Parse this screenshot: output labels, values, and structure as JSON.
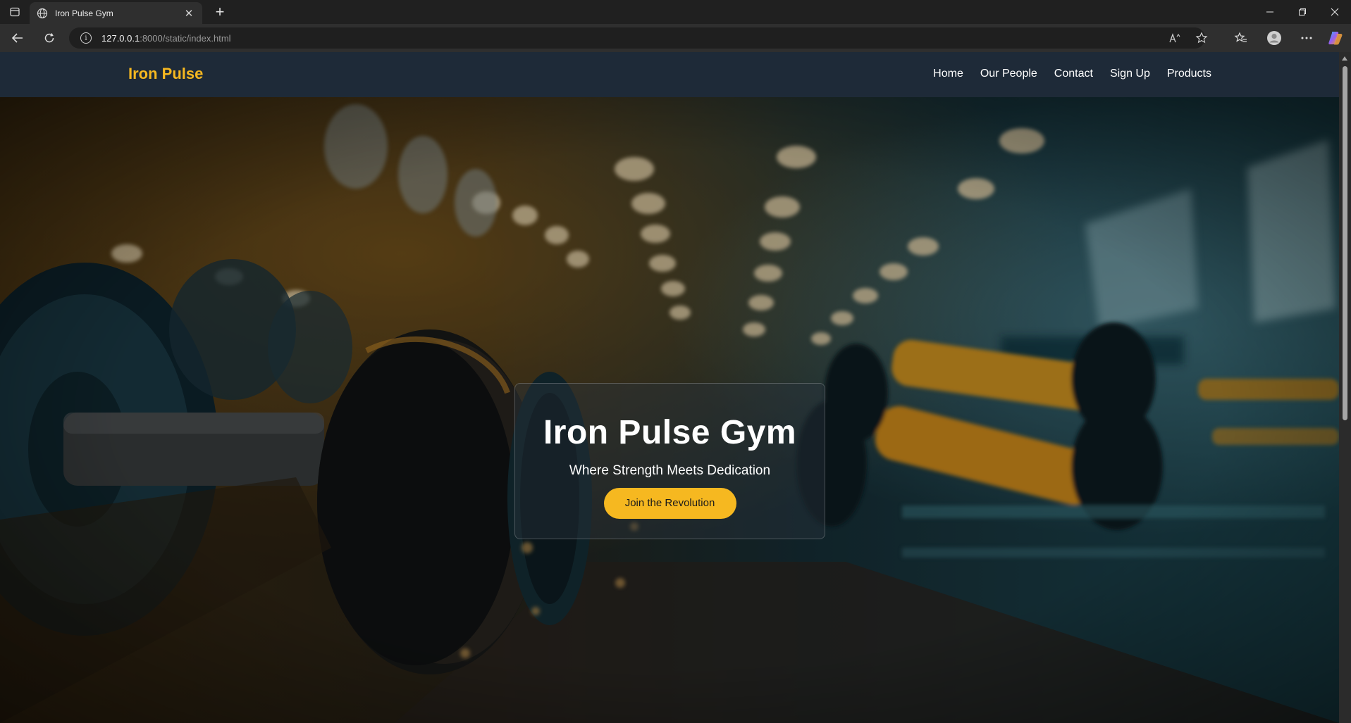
{
  "browser": {
    "tab_title": "Iron Pulse Gym",
    "url_host": "127.0.0.1",
    "url_path": ":8000/static/index.html",
    "read_aloud_label": "Á"
  },
  "site": {
    "brand": "Iron Pulse",
    "nav": [
      "Home",
      "Our People",
      "Contact",
      "Sign Up",
      "Products"
    ],
    "hero": {
      "title": "Iron Pulse Gym",
      "subtitle": "Where Strength Meets Dedication",
      "cta": "Join the Revolution"
    }
  },
  "colors": {
    "accent": "#f6b820",
    "nav_bg": "#1e2a38",
    "chrome_bg": "#202020"
  }
}
